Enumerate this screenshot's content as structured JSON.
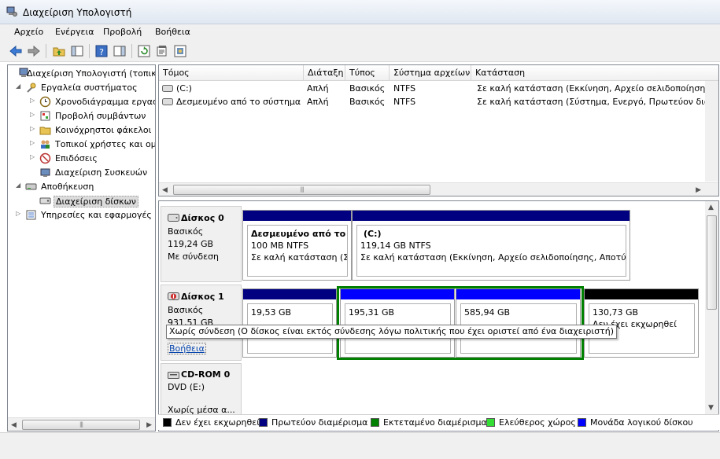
{
  "window": {
    "title": "Διαχείριση Υπολογιστή"
  },
  "menu": [
    "Αρχείο",
    "Ενέργεια",
    "Προβολή",
    "Βοήθεια"
  ],
  "tree": [
    {
      "label": "Διαχείριση Υπολογιστή (τοπικ",
      "icon": "computer-icon",
      "level": 0,
      "toggle": ""
    },
    {
      "label": "Εργαλεία συστήματος",
      "icon": "tools-icon",
      "level": 1,
      "toggle": "◢"
    },
    {
      "label": "Χρονοδιάγραμμα εργασ",
      "icon": "clock-icon",
      "level": 2,
      "toggle": "▷"
    },
    {
      "label": "Προβολή συμβάντων",
      "icon": "event-viewer-icon",
      "level": 2,
      "toggle": "▷"
    },
    {
      "label": "Κοινόχρηστοι φάκελοι",
      "icon": "shared-folder-icon",
      "level": 2,
      "toggle": "▷"
    },
    {
      "label": "Τοπικοί χρήστες και ομ",
      "icon": "users-icon",
      "level": 2,
      "toggle": "▷"
    },
    {
      "label": "Επιδόσεις",
      "icon": "performance-icon",
      "level": 2,
      "toggle": "▷"
    },
    {
      "label": "Διαχείριση Συσκευών",
      "icon": "device-manager-icon",
      "level": 2,
      "toggle": ""
    },
    {
      "label": "Αποθήκευση",
      "icon": "storage-icon",
      "level": 1,
      "toggle": "◢"
    },
    {
      "label": "Διαχείριση δίσκων",
      "icon": "disk-management-icon",
      "level": 2,
      "toggle": "",
      "selected": true
    },
    {
      "label": "Υπηρεσίες και εφαρμογές",
      "icon": "services-icon",
      "level": 1,
      "toggle": "▷"
    }
  ],
  "volume_list": {
    "columns": [
      "Τόμος",
      "Διάταξη",
      "Τύπος",
      "Σύστημα αρχείων",
      "Κατάσταση"
    ],
    "rows": [
      {
        "volume": "(C:)",
        "layout": "Απλή",
        "type": "Βασικός",
        "fs": "NTFS",
        "status": "Σε καλή κατάσταση (Εκκίνηση, Αρχείο σελιδοποίησης, Απ"
      },
      {
        "volume": "Δεσμευμένο από το σύστημα",
        "layout": "Απλή",
        "type": "Βασικός",
        "fs": "NTFS",
        "status": "Σε καλή κατάσταση (Σύστημα, Ενεργό, Πρωτεύον διαμέρ"
      }
    ]
  },
  "disks": [
    {
      "title": "Δίσκος 0",
      "type": "Βασικός",
      "size": "119,24 GB",
      "status": "Με σύνδεση",
      "help": "",
      "partitions": [
        {
          "name": "Δεσμευμένο από το σ",
          "line2": "100 MB NTFS",
          "line3": "Σε καλή κατάσταση (Σύ",
          "bar": "primary"
        },
        {
          "name": "(C:)",
          "line2": "119,14 GB NTFS",
          "line3": "Σε καλή κατάσταση (Εκκίνηση, Αρχείο σελιδοποίησης, Αποτύπω",
          "bar": "primary"
        }
      ]
    },
    {
      "title": "Δίσκος 1",
      "type": "Βασικός",
      "size": "931,51 GB",
      "status": "",
      "help": "Βοήθεια",
      "partitions": [
        {
          "name": "",
          "line2": "19,53 GB",
          "line3": "",
          "bar": "primary"
        },
        {
          "name": "",
          "line2": "195,31 GB",
          "line3": "",
          "bar": "logical"
        },
        {
          "name": "",
          "line2": "585,94 GB",
          "line3": "",
          "bar": "logical"
        },
        {
          "name": "",
          "line2": "130,73 GB",
          "line3": "Δεν έχει εκχωρηθεί",
          "bar": "unallocated"
        }
      ]
    },
    {
      "title": "CD-ROM 0",
      "type": "DVD (E:)",
      "size": "",
      "status": "Χωρίς μέσα α...",
      "help": "",
      "partitions": []
    }
  ],
  "tooltip": "Χωρίς σύνδεση (Ο δίσκος είναι εκτός σύνδεσης λόγω πολιτικής που έχει οριστεί από ένα διαχειριστή)",
  "legend": [
    {
      "label": "Δεν έχει εκχωρηθεί",
      "color": "#000000"
    },
    {
      "label": "Πρωτεύον διαμέρισμα",
      "color": "#000080"
    },
    {
      "label": "Εκτεταμένο διαμέρισμα",
      "color": "#008000"
    },
    {
      "label": "Ελεύθερος χώρος",
      "color": "#33dd33"
    },
    {
      "label": "Μονάδα λογικού δίσκου",
      "color": "#0000ff"
    }
  ],
  "colors": {
    "primary": "#000080",
    "logical": "#0000ff",
    "unallocated": "#000000",
    "extended": "#008000"
  }
}
